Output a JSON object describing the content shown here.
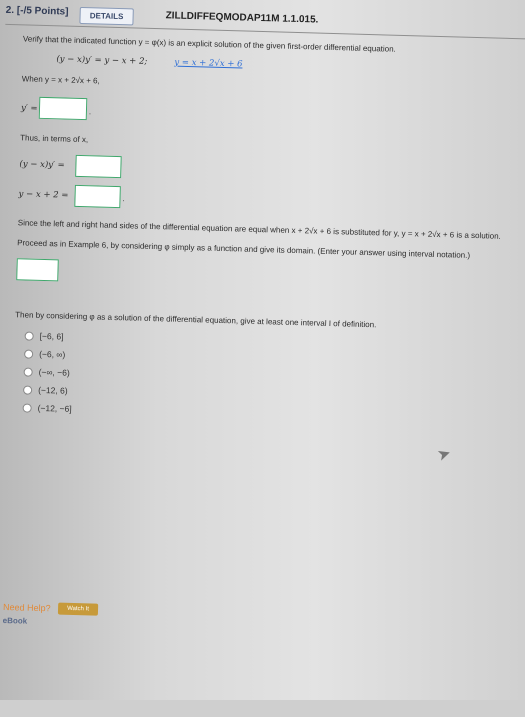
{
  "header": {
    "points": "2. [-/5 Points]",
    "details_label": "DETAILS",
    "reference": "ZILLDIFFEQMODAP11M 1.1.015."
  },
  "problem": {
    "intro": "Verify that the indicated function y = φ(x) is an explicit solution of the given first-order differential equation.",
    "equation_1": "(y − x)y′ = y − x + 2;",
    "equation_2": "y = x + 2√x + 6",
    "when_text": "When y = x + 2√x + 6,",
    "yprime_label": "y′ =",
    "thus_text": "Thus, in terms of x,",
    "lhs_label": "(y − x)y′ =",
    "rhs_label": "y − x + 2 =",
    "since_text": "Since the left and right hand sides of the differential equation are equal when x + 2√x + 6 is substituted for y, y = x + 2√x + 6 is a solution.",
    "proceed_text": "Proceed as in Example 6, by considering φ simply as a function and give its domain. (Enter your answer using interval notation.)",
    "then_text": "Then by considering φ as a solution of the differential equation, give at least one interval I of definition."
  },
  "options": [
    "[−6, 6]",
    "(−6, ∞)",
    "(−∞, −6)",
    "(−12, 6)",
    "(−12, −6]"
  ],
  "help": {
    "need_help": "Need Help?",
    "watch_it": "Watch It",
    "ebook": "eBook"
  },
  "colors": {
    "answer_box_border": "#3fa66b",
    "highlight": "#2f6fd6",
    "need_help": "#e08a3a"
  }
}
